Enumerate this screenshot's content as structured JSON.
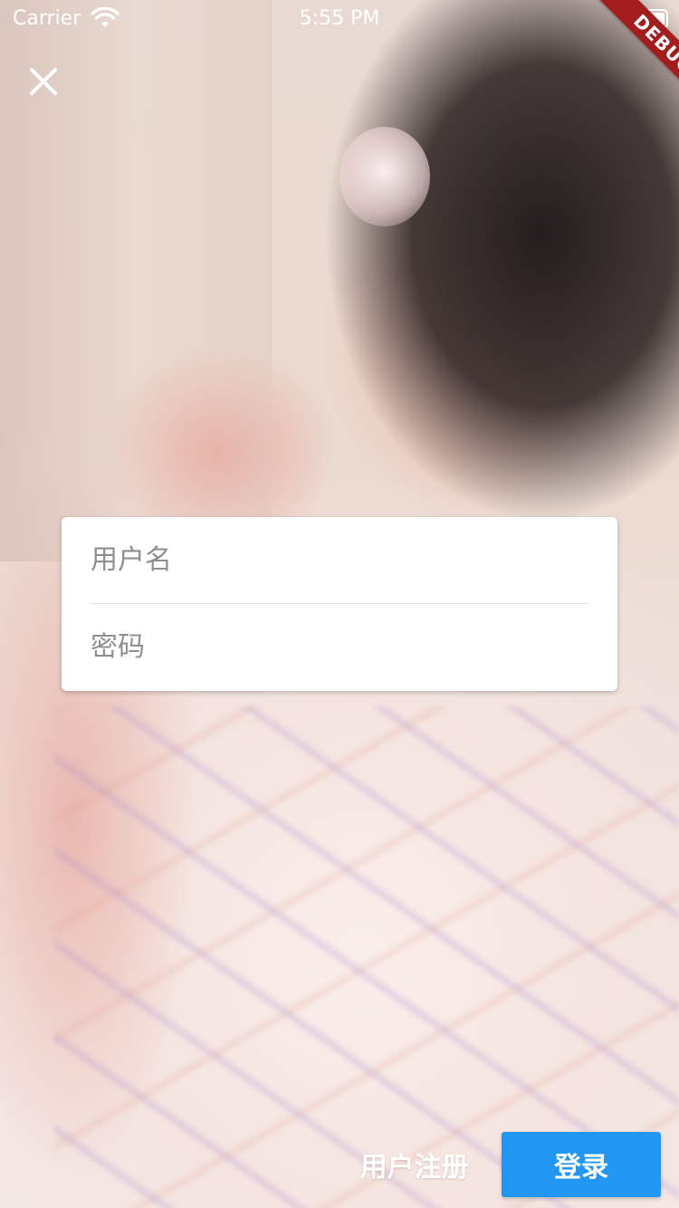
{
  "status_bar": {
    "carrier": "Carrier",
    "time": "5:55 PM",
    "wifi_icon": "wifi-icon",
    "battery_icon": "battery-icon"
  },
  "debug_banner": {
    "label": "DEBUG",
    "color": "#a31d1d"
  },
  "header": {
    "close_icon": "close-icon"
  },
  "login_form": {
    "username_placeholder": "用户名",
    "username_value": "",
    "password_placeholder": "密码",
    "password_value": ""
  },
  "actions": {
    "register_label": "用户注册",
    "login_label": "登录",
    "login_color": "#2196f3"
  },
  "background": {
    "description": "blurred photo",
    "dominant_colors": [
      "#e8d9d2",
      "#1e1818",
      "#f4e8e5"
    ]
  }
}
